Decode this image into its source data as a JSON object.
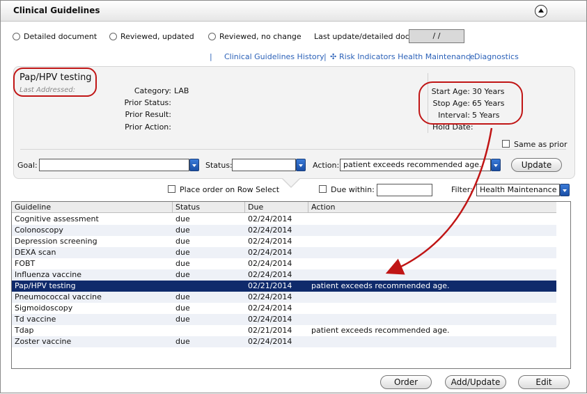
{
  "window": {
    "title": "Clinical Guidelines"
  },
  "review_options": {
    "detailed": "Detailed document",
    "reviewed_updated": "Reviewed, updated",
    "reviewed_nochange": "Reviewed, no change",
    "last_update_label": "Last update/detailed doc:",
    "last_update_value": "/ /"
  },
  "links": {
    "history": "Clinical Guidelines History",
    "risk": "Risk Indicators Health Maintenance",
    "diagnostics": "Diagnostics"
  },
  "detail": {
    "name": "Pap/HPV testing",
    "last_addressed": "Last Addressed:",
    "category_label": "Category:",
    "category_value": "LAB",
    "prior_status_label": "Prior Status:",
    "prior_result_label": "Prior Result:",
    "prior_action_label": "Prior Action:",
    "start_age_label": "Start Age:",
    "start_age_value": "30 Years",
    "stop_age_label": "Stop Age:",
    "stop_age_value": "65 Years",
    "interval_label": "Interval:",
    "interval_value": "5 Years",
    "hold_date_label": "Hold Date:",
    "same_as_prior": "Same as prior",
    "goal_label": "Goal:",
    "goal_value": "",
    "status_label": "Status:",
    "status_value": "",
    "action_label": "Action:",
    "action_value": "patient exceeds recommended age.",
    "update_button": "Update"
  },
  "filters": {
    "place_order": "Place order on Row Select",
    "due_within": "Due within:",
    "due_within_value": "",
    "filter_label": "Filter:",
    "filter_value": "Health Maintenance"
  },
  "table": {
    "columns": [
      "Guideline",
      "Status",
      "Due",
      "Action"
    ],
    "rows": [
      {
        "guideline": "Cognitive assessment",
        "status": "due",
        "due": "02/24/2014",
        "action": ""
      },
      {
        "guideline": "Colonoscopy",
        "status": "due",
        "due": "02/24/2014",
        "action": ""
      },
      {
        "guideline": "Depression screening",
        "status": "due",
        "due": "02/24/2014",
        "action": ""
      },
      {
        "guideline": "DEXA scan",
        "status": "due",
        "due": "02/24/2014",
        "action": ""
      },
      {
        "guideline": "FOBT",
        "status": "due",
        "due": "02/24/2014",
        "action": ""
      },
      {
        "guideline": "Influenza vaccine",
        "status": "due",
        "due": "02/24/2014",
        "action": ""
      },
      {
        "guideline": "Pap/HPV testing",
        "status": "",
        "due": "02/21/2014",
        "action": "patient exceeds recommended age."
      },
      {
        "guideline": "Pneumococcal vaccine",
        "status": "due",
        "due": "02/24/2014",
        "action": ""
      },
      {
        "guideline": "Sigmoidoscopy",
        "status": "due",
        "due": "02/24/2014",
        "action": ""
      },
      {
        "guideline": "Td vaccine",
        "status": "due",
        "due": "02/24/2014",
        "action": ""
      },
      {
        "guideline": "Tdap",
        "status": "",
        "due": "02/21/2014",
        "action": "patient exceeds recommended age."
      },
      {
        "guideline": "Zoster vaccine",
        "status": "due",
        "due": "02/24/2014",
        "action": ""
      }
    ]
  },
  "buttons": {
    "order": "Order",
    "add_update": "Add/Update",
    "edit": "Edit"
  },
  "colors": {
    "selected_row": "#0f2a6b",
    "link": "#2b61b8",
    "annotation": "#c01515"
  },
  "icons": {
    "collapse": "chevron-up-icon",
    "dropdown": "chevron-down-icon"
  }
}
